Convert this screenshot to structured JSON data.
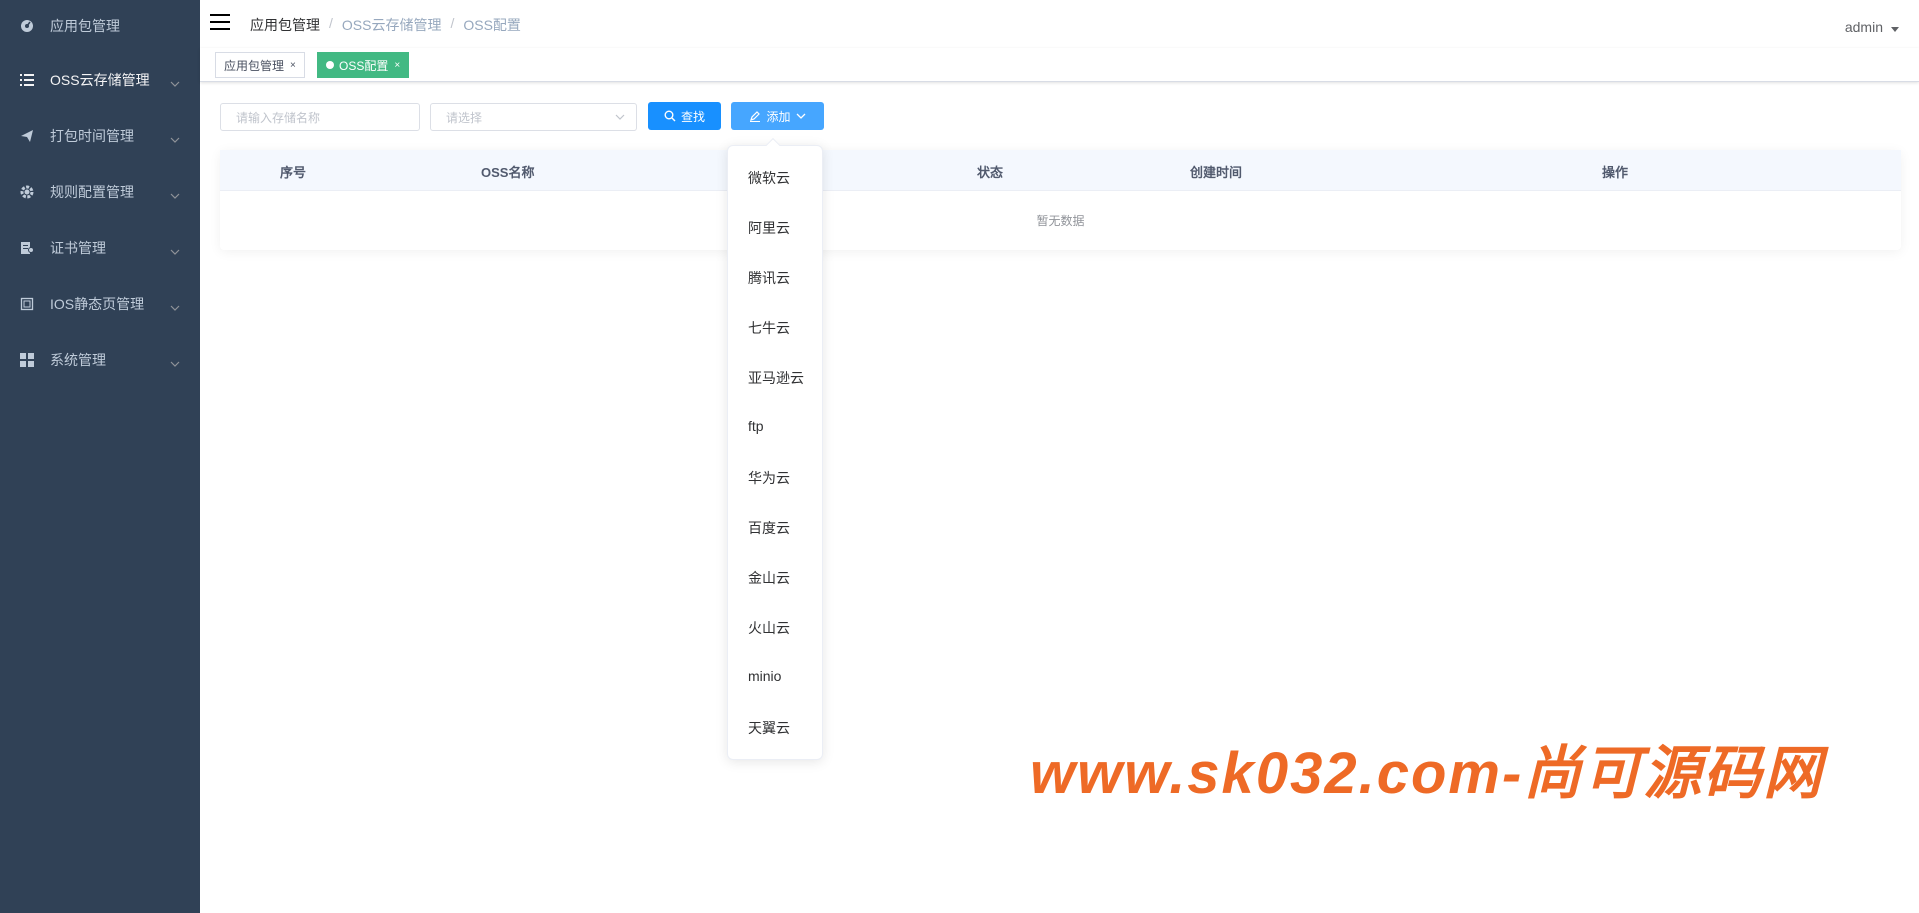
{
  "sidebar": {
    "items": [
      {
        "label": "应用包管理",
        "icon": "dashboard-icon",
        "has_arrow": false
      },
      {
        "label": "OSS云存储管理",
        "icon": "list-icon",
        "has_arrow": true
      },
      {
        "label": "打包时间管理",
        "icon": "send-icon",
        "has_arrow": true
      },
      {
        "label": "规则配置管理",
        "icon": "gear-icon",
        "has_arrow": true
      },
      {
        "label": "证书管理",
        "icon": "certificate-icon",
        "has_arrow": true
      },
      {
        "label": "IOS静态页管理",
        "icon": "page-icon",
        "has_arrow": true
      },
      {
        "label": "系统管理",
        "icon": "grid-icon",
        "has_arrow": true
      }
    ]
  },
  "navbar": {
    "breadcrumb": [
      "应用包管理",
      "OSS云存储管理",
      "OSS配置"
    ],
    "user": "admin"
  },
  "tags": [
    {
      "label": "应用包管理",
      "active": false
    },
    {
      "label": "OSS配置",
      "active": true
    }
  ],
  "filters": {
    "name_placeholder": "请输入存储名称",
    "select_placeholder": "请选择",
    "search_label": "查找",
    "add_label": "添加"
  },
  "table": {
    "columns": [
      "序号",
      "OSS名称",
      "状态",
      "创建时间",
      "操作"
    ],
    "empty_text": "暂无数据"
  },
  "add_dropdown": {
    "items": [
      "微软云",
      "阿里云",
      "腾讯云",
      "七牛云",
      "亚马逊云",
      "ftp",
      "华为云",
      "百度云",
      "金山云",
      "火山云",
      "minio",
      "天翼云"
    ]
  },
  "watermark": "www.sk032.com-尚可源码网",
  "colors": {
    "sidebar_bg": "#304156",
    "primary": "#1890ff",
    "add_button": "#46a6ff",
    "tag_active": "#42b983",
    "watermark": "#ee6a26"
  }
}
